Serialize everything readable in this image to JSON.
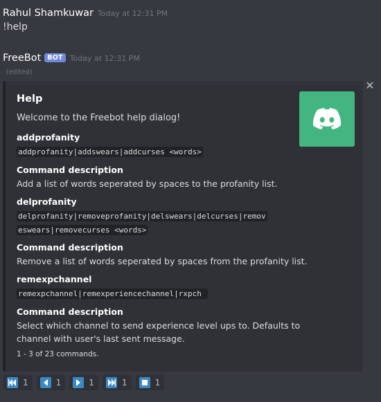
{
  "messages": [
    {
      "author": "Rahul Shamkuwar",
      "timestamp": "Today at 12:31 PM",
      "content": "!help"
    },
    {
      "author": "FreeBot",
      "badge": "BOT",
      "timestamp": "Today at 12:31 PM",
      "edited": "(edited)"
    }
  ],
  "embed": {
    "title": "Help",
    "description": "Welcome to the Freebot help dialog!",
    "thumbnail_color": "#43b581",
    "fields": [
      {
        "name": "addprofanity",
        "value": "addprofanity|addswears|addcurses <words>"
      },
      {
        "name": "Command description",
        "value": "Add a list of words seperated by spaces to the profanity list."
      },
      {
        "name": "delprofanity",
        "value_lines": [
          "delprofanity|removeprofanity|delswears|delcurses|remov",
          "eswears|removecurses <words>"
        ]
      },
      {
        "name": "Command description",
        "value": "Remove a list of words seperated by spaces from the profanity list."
      },
      {
        "name": "remexpchannel",
        "value": "remexpchannel|remexperiencechannel|rxpch "
      },
      {
        "name": "Command description",
        "value_lines": [
          "Select which channel to send experience level ups to. Defaults to",
          "channel with user's last sent message."
        ]
      }
    ],
    "footer": "1 - 3 of 23 commands."
  },
  "reactions": [
    {
      "icon": "first-page-icon",
      "count": "1"
    },
    {
      "icon": "previous-icon",
      "count": "1"
    },
    {
      "icon": "next-icon",
      "count": "1"
    },
    {
      "icon": "last-page-icon",
      "count": "1"
    },
    {
      "icon": "stop-icon",
      "count": "1"
    }
  ],
  "colors": {
    "background": "#36393f",
    "embed_bg": "#2f3136",
    "reaction_icon": "#3b88c3",
    "badge": "#7289da"
  }
}
